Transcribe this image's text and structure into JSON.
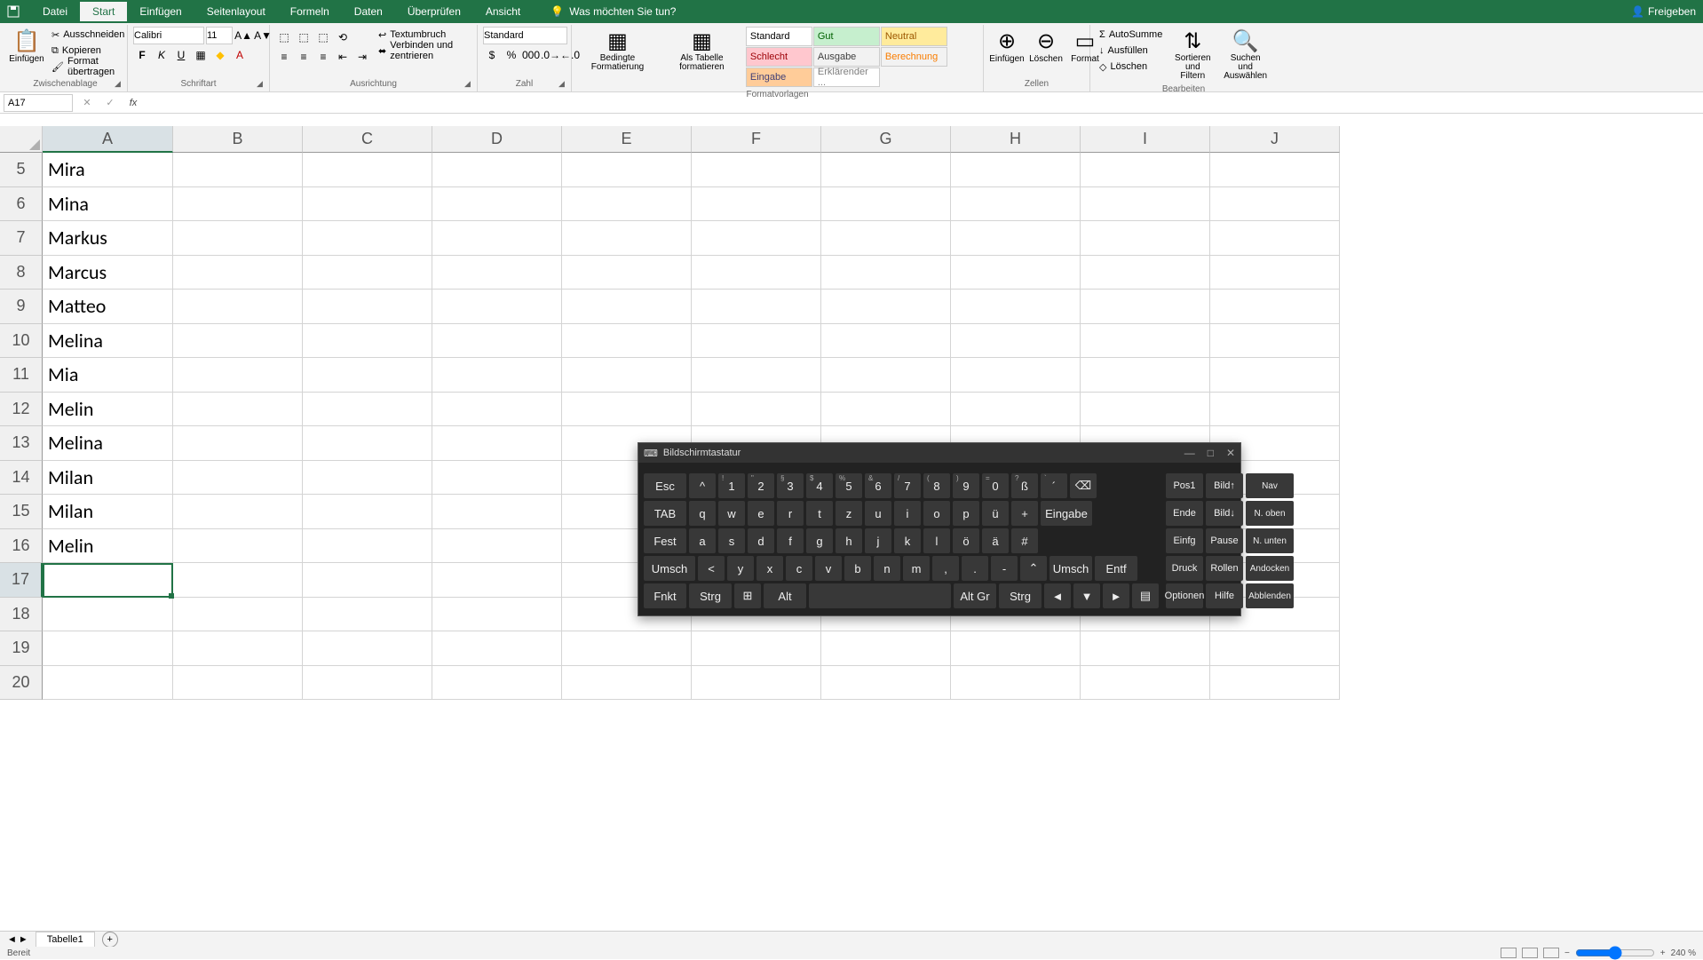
{
  "titlebar": {
    "tabs": [
      "Datei",
      "Start",
      "Einfügen",
      "Seitenlayout",
      "Formeln",
      "Daten",
      "Überprüfen",
      "Ansicht"
    ],
    "active_tab": "Start",
    "tell_me": "Was möchten Sie tun?",
    "share": "Freigeben"
  },
  "ribbon": {
    "clipboard": {
      "paste": "Einfügen",
      "cut": "Ausschneiden",
      "copy": "Kopieren",
      "format_painter": "Format übertragen",
      "label": "Zwischenablage"
    },
    "font": {
      "name": "Calibri",
      "size": "11",
      "label": "Schriftart"
    },
    "alignment": {
      "wrap": "Textumbruch",
      "merge": "Verbinden und zentrieren",
      "label": "Ausrichtung"
    },
    "number": {
      "format": "Standard",
      "label": "Zahl"
    },
    "styles": {
      "conditional": "Bedingte Formatierung",
      "table": "Als Tabelle formatieren",
      "cells": [
        {
          "label": "Standard",
          "bg": "#fff",
          "color": "#000"
        },
        {
          "label": "Gut",
          "bg": "#c6efce",
          "color": "#006100"
        },
        {
          "label": "Neutral",
          "bg": "#ffeb9c",
          "color": "#9c5700"
        },
        {
          "label": "Schlecht",
          "bg": "#ffc7ce",
          "color": "#9c0006"
        },
        {
          "label": "Ausgabe",
          "bg": "#f2f2f2",
          "color": "#3f3f3f"
        },
        {
          "label": "Berechnung",
          "bg": "#f2f2f2",
          "color": "#fa7d00"
        },
        {
          "label": "Eingabe",
          "bg": "#ffcc99",
          "color": "#3f3f76"
        },
        {
          "label": "Erklärender ...",
          "bg": "#fff",
          "color": "#7f7f7f"
        }
      ],
      "label": "Formatvorlagen"
    },
    "cells_group": {
      "insert": "Einfügen",
      "delete": "Löschen",
      "format": "Format",
      "label": "Zellen"
    },
    "editing": {
      "autosum": "AutoSumme",
      "fill": "Ausfüllen",
      "clear": "Löschen",
      "sort": "Sortieren und Filtern",
      "find": "Suchen und Auswählen",
      "label": "Bearbeiten"
    }
  },
  "name_box": "A17",
  "formula": "",
  "columns": [
    "A",
    "B",
    "C",
    "D",
    "E",
    "F",
    "G",
    "H",
    "I",
    "J"
  ],
  "selected_col": "A",
  "rows": [
    {
      "n": 5,
      "A": "Mira"
    },
    {
      "n": 6,
      "A": "Mina"
    },
    {
      "n": 7,
      "A": "Markus"
    },
    {
      "n": 8,
      "A": "Marcus"
    },
    {
      "n": 9,
      "A": "Matteo"
    },
    {
      "n": 10,
      "A": "Melina"
    },
    {
      "n": 11,
      "A": "Mia"
    },
    {
      "n": 12,
      "A": "Melin"
    },
    {
      "n": 13,
      "A": "Melina"
    },
    {
      "n": 14,
      "A": "Milan"
    },
    {
      "n": 15,
      "A": "Milan"
    },
    {
      "n": 16,
      "A": "Melin"
    },
    {
      "n": 17,
      "A": ""
    },
    {
      "n": 18,
      "A": ""
    },
    {
      "n": 19,
      "A": ""
    },
    {
      "n": 20,
      "A": ""
    }
  ],
  "selected_row": 17,
  "sheet_tab": "Tabelle1",
  "status": "Bereit",
  "zoom": "240 %",
  "osk": {
    "title": "Bildschirmtastatur",
    "row1": [
      "Esc",
      "^",
      "1",
      "2",
      "3",
      "4",
      "5",
      "6",
      "7",
      "8",
      "9",
      "0",
      "ß",
      "´",
      "⌫"
    ],
    "row1_sup": [
      "",
      "",
      "!",
      "\"",
      "§",
      "$",
      "%",
      "&",
      "/",
      "(",
      ")",
      "=",
      "?",
      "`",
      ""
    ],
    "row2": [
      "TAB",
      "q",
      "w",
      "e",
      "r",
      "t",
      "z",
      "u",
      "i",
      "o",
      "p",
      "ü",
      "+",
      "Eingabe"
    ],
    "row3": [
      "Fest",
      "a",
      "s",
      "d",
      "f",
      "g",
      "h",
      "j",
      "k",
      "l",
      "ö",
      "ä",
      "#"
    ],
    "row4": [
      "Umsch",
      "<",
      "y",
      "x",
      "c",
      "v",
      "b",
      "n",
      "m",
      ",",
      ".",
      "-",
      "⌃",
      "Umsch",
      "Entf"
    ],
    "row5": [
      "Fnkt",
      "Strg",
      "⊞",
      "Alt",
      " ",
      "Alt Gr",
      "Strg",
      "◄",
      "▼",
      "►",
      "▤"
    ],
    "side": [
      [
        "Pos1",
        "Bild↑",
        "Nav"
      ],
      [
        "Ende",
        "Bild↓",
        "N. oben"
      ],
      [
        "Einfg",
        "Pause",
        "N. unten"
      ],
      [
        "Druck",
        "Rollen",
        "Andocken"
      ],
      [
        "Optionen",
        "Hilfe",
        "Abblenden"
      ]
    ]
  }
}
